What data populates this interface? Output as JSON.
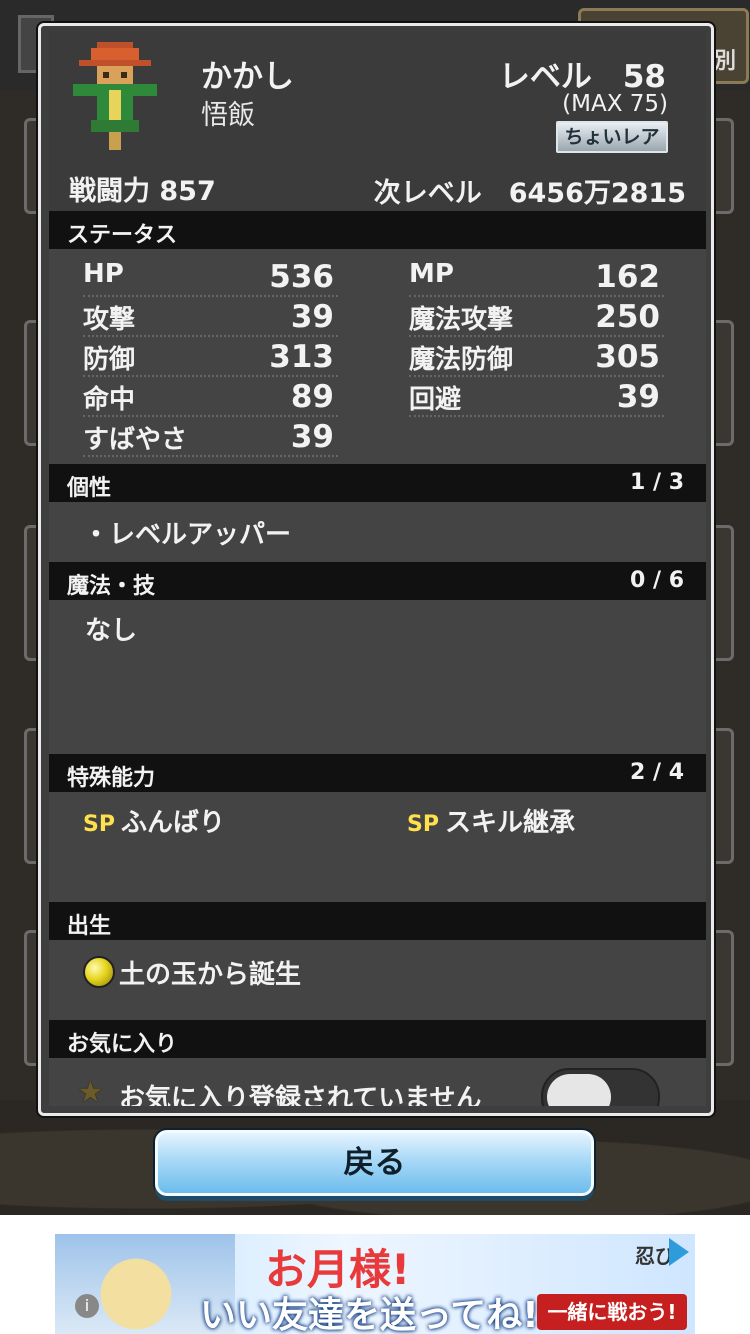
{
  "background": {
    "tab_label": "別"
  },
  "character": {
    "name": "かかし",
    "subname": "悟飯",
    "level_text": "レベル　58",
    "level_max": "(MAX 75)",
    "rarity": "ちょいレア",
    "power": "戦闘力 857",
    "next_level": "次レベル　6456万2815"
  },
  "status": {
    "title": "ステータス",
    "left": [
      {
        "k": "HP",
        "v": "536"
      },
      {
        "k": "攻撃",
        "v": "39"
      },
      {
        "k": "防御",
        "v": "313"
      },
      {
        "k": "命中",
        "v": "89"
      },
      {
        "k": "すばやさ",
        "v": "39"
      }
    ],
    "right": [
      {
        "k": "MP",
        "v": "162"
      },
      {
        "k": "魔法攻撃",
        "v": "250"
      },
      {
        "k": "魔法防御",
        "v": "305"
      },
      {
        "k": "回避",
        "v": "39"
      }
    ]
  },
  "traits": {
    "title": "個性",
    "count": "1 / 3",
    "items": [
      "・レベルアッパー"
    ]
  },
  "magic": {
    "title": "魔法・技",
    "count": "0 / 6",
    "empty": "なし"
  },
  "special": {
    "title": "特殊能力",
    "count": "2 / 4",
    "badge": "SP",
    "items": [
      "ふんばり",
      "スキル継承"
    ]
  },
  "origin": {
    "title": "出生",
    "text": "土の玉から誕生"
  },
  "favorite": {
    "title": "お気に入り",
    "text": "お気に入り登録されていません",
    "enabled": false
  },
  "back_button": "戻る",
  "ad": {
    "line1": "お月様!",
    "line2": "いい友達を送ってね!",
    "logo": "忍び",
    "cta": "一緒に戦おう!",
    "info": "i"
  }
}
